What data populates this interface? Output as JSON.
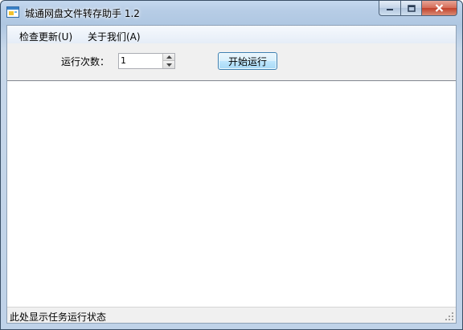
{
  "window": {
    "title": "城通网盘文件转存助手 1.2"
  },
  "menu": {
    "items": [
      "检查更新(U)",
      "关于我们(A)"
    ]
  },
  "controls": {
    "run_count_label": "运行次数：",
    "run_count_value": "1",
    "start_button_label": "开始运行"
  },
  "status": {
    "text": "此处显示任务运行状态"
  },
  "icons": {
    "app": "app-window-icon",
    "minimize": "minimize-icon",
    "maximize": "maximize-icon",
    "close": "close-icon",
    "spin_up": "arrow-up-icon",
    "spin_down": "arrow-down-icon",
    "grip": "resize-grip-icon"
  },
  "colors": {
    "close_button": "#c2412b",
    "button_border": "#3c7fb1"
  }
}
